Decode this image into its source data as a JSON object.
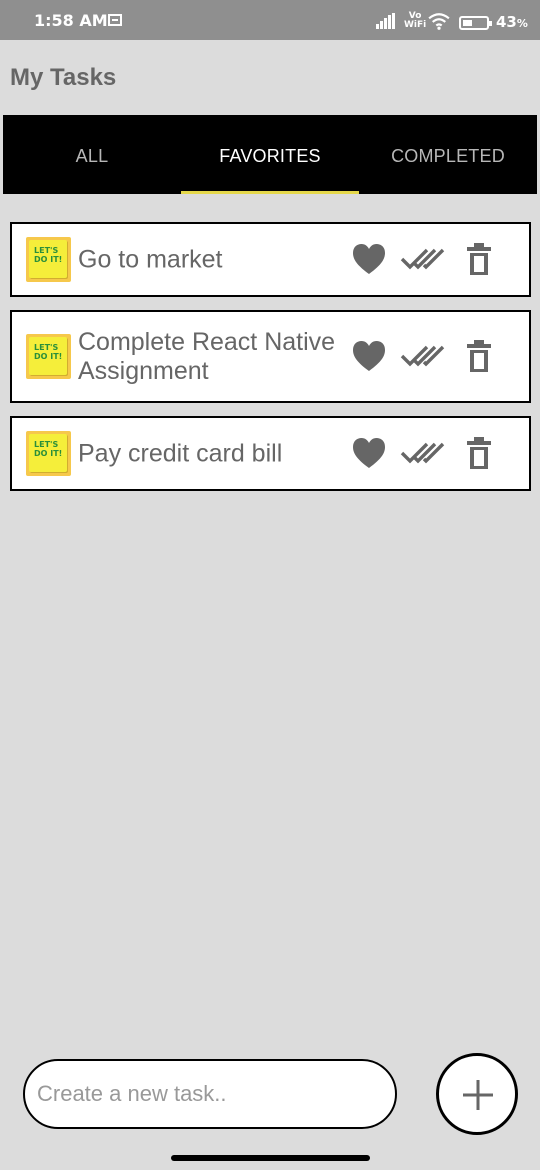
{
  "status_bar": {
    "time": "1:58 AM",
    "vo_label": "Vo",
    "wifi_label": "WiFi",
    "battery_percent": "43",
    "battery_suffix": "%",
    "battery_level": 0.43
  },
  "header": {
    "title": "My Tasks"
  },
  "tabs": [
    {
      "label": "ALL",
      "active": false
    },
    {
      "label": "FAVORITES",
      "active": true
    },
    {
      "label": "COMPLETED",
      "active": false
    }
  ],
  "tasks": [
    {
      "title": "Go to market",
      "thumbnail_text": "LET'S DO IT!",
      "favorite": true
    },
    {
      "title": "Complete React Native Assignment",
      "thumbnail_text": "LET'S DO IT!",
      "favorite": true
    },
    {
      "title": "Pay credit card bill",
      "thumbnail_text": "LET'S DO IT!",
      "favorite": true
    }
  ],
  "composer": {
    "placeholder": "Create a new task..",
    "value": ""
  },
  "icons": {
    "favorite": "heart-icon",
    "complete": "double-check-icon",
    "delete": "trash-icon",
    "add": "plus-icon"
  },
  "colors": {
    "background": "#dcdcdc",
    "tab_bar": "#000000",
    "tab_indicator": "#e5d84b",
    "icon": "#666666"
  }
}
